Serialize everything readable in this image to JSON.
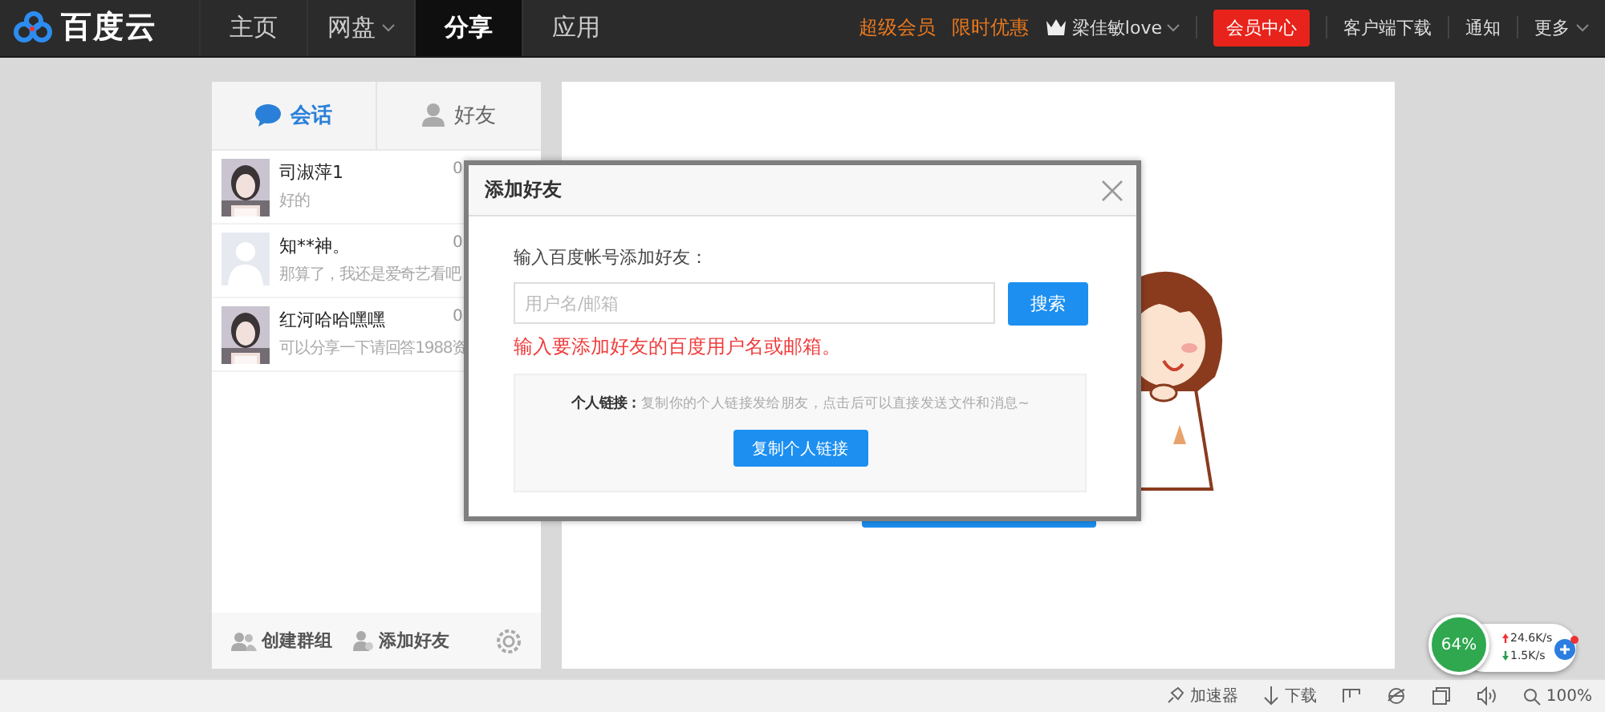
{
  "header": {
    "logo": "百度云",
    "nav": [
      {
        "label": "主页",
        "selected": false,
        "caret": false
      },
      {
        "label": "网盘",
        "selected": false,
        "caret": true
      },
      {
        "label": "分享",
        "selected": true,
        "caret": false
      },
      {
        "label": "应用",
        "selected": false,
        "caret": false
      }
    ],
    "promos": [
      "超级会员",
      "限时优惠"
    ],
    "user": {
      "name": "梁佳敏love",
      "caret": true
    },
    "vip_button": "会员中心",
    "links": [
      {
        "label": "客户端下载",
        "caret": false
      },
      {
        "label": "通知",
        "caret": false
      },
      {
        "label": "更多",
        "caret": true
      }
    ]
  },
  "sidebar": {
    "tabs": [
      {
        "label": "会话",
        "selected": true
      },
      {
        "label": "好友",
        "selected": false
      }
    ],
    "conversations": [
      {
        "name": "司淑萍1",
        "preview": "好的",
        "time": "0"
      },
      {
        "name": "知**神。",
        "preview": "那算了，我还是爱奇艺看吧",
        "time": "0",
        "kind": "default"
      },
      {
        "name": "红河哈哈嘿嘿",
        "preview": "可以分享一下请回答1988资",
        "time": "0"
      }
    ],
    "footer": [
      {
        "kind": "group",
        "label": "创建群组"
      },
      {
        "kind": "add",
        "label": "添加好友"
      },
      {
        "kind": "settings"
      }
    ]
  },
  "dialog": {
    "title": "添加好友",
    "prompt": "输入百度帐号添加好友：",
    "placeholder": "用户名/邮箱",
    "search_button": "搜索",
    "error": "输入要添加好友的百度用户名或邮箱。",
    "link_text": "**个人链接：**复制你的个人链接发给朋友，点击后可以直接发送文件和消息~",
    "copy_button": "复制个人链接"
  },
  "speed_widget": {
    "percent": "64%",
    "upload": "24.6K/s",
    "download": "1.5K/s"
  },
  "status_bar": {
    "items": [
      {
        "kind": "accelerator",
        "label": "加速器"
      },
      {
        "kind": "download",
        "label": "下载"
      },
      {
        "kind": "layout"
      },
      {
        "kind": "browser"
      },
      {
        "kind": "window"
      },
      {
        "kind": "sound"
      },
      {
        "kind": "zoom",
        "label": "100%"
      }
    ]
  }
}
